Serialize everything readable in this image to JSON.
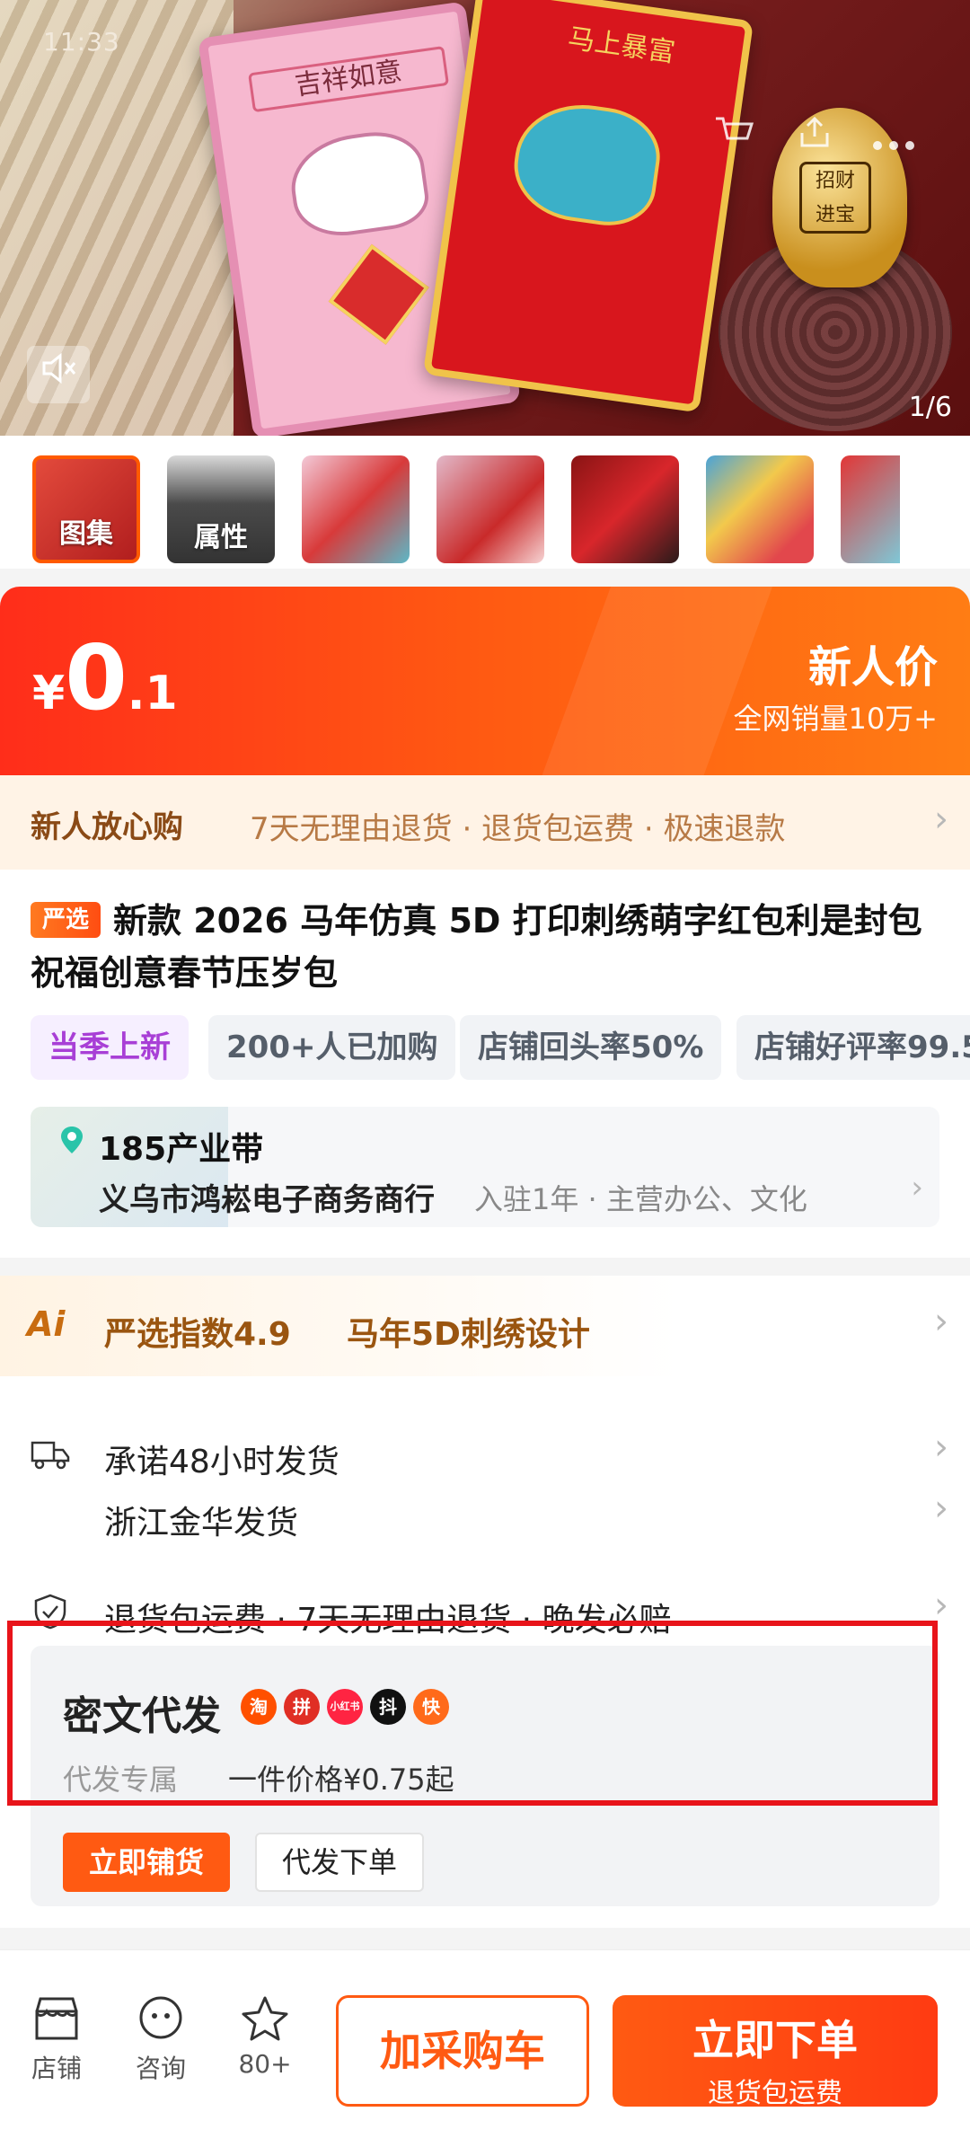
{
  "status_bar": {
    "time": "11:33"
  },
  "gallery": {
    "page_indicator": "1/6"
  },
  "thumbnails": {
    "items": [
      {
        "label": "图集"
      },
      {
        "label": "属性"
      },
      {
        "label": ""
      },
      {
        "label": ""
      },
      {
        "label": ""
      },
      {
        "label": ""
      },
      {
        "label": ""
      }
    ]
  },
  "price": {
    "symbol": "¥",
    "integer": "0",
    "decimal": ".1",
    "tag": "新人价",
    "sales": "全网销量10万+"
  },
  "guarantee": {
    "title": "新人放心购",
    "details": "7天无理由退货 · 退货包运费 · 极速退款"
  },
  "product": {
    "badge": "严选",
    "title": "新款 2026 马年仿真 5D 打印刺绣萌字红包利是封包祝福创意春节压岁包",
    "chips": [
      "当季上新",
      "200+人已加购",
      "店铺回头率50%",
      "店铺好评率99.5"
    ]
  },
  "store": {
    "belt": "185产业带",
    "name": "义乌市鸿崧电子商务商行",
    "meta": "入驻1年 · 主营办公、文化"
  },
  "ai": {
    "label": "Ai",
    "index": "严选指数4.9",
    "feature": "马年5D刺绣设计"
  },
  "services": {
    "ship_promise": "承诺48小时发货",
    "ship_from": "浙江金华发货",
    "returns": "退货包运费 · 7天无理由退货 · 晚发必赔"
  },
  "daifa": {
    "title": "密文代发",
    "platforms": [
      "淘",
      "拼",
      "小红书",
      "抖",
      "快"
    ],
    "sub_label": "代发专属",
    "price_text": "一件价格¥0.75起",
    "stock_button": "立即铺货",
    "order_button": "代发下单"
  },
  "bottom_bar": {
    "store_label": "店铺",
    "consult_label": "咨询",
    "fav_count": "80+",
    "cart_button": "加采购车",
    "buy_button": "立即下单",
    "buy_sub": "退货包运费"
  },
  "colors": {
    "accent": "#ff5a12",
    "price_red": "#ff2d1a",
    "highlight_red": "#e8141a"
  }
}
